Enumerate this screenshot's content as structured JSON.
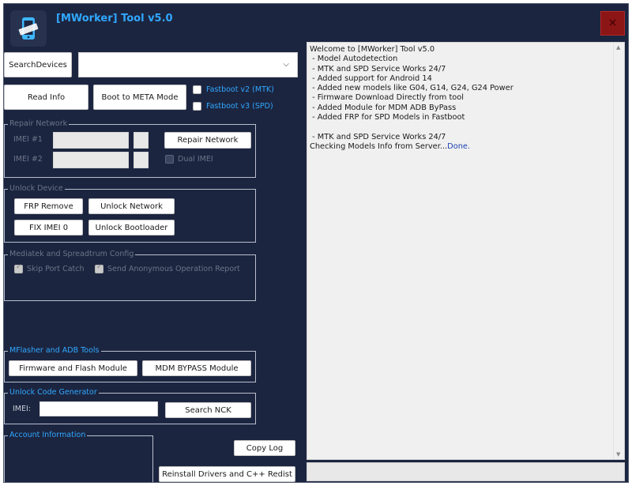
{
  "window": {
    "title": "[MWorker] Tool v5.0",
    "close_label": "×",
    "logo_icon": "phone-tool-icon"
  },
  "toolbar": {
    "search_devices_label": "SearchDevices",
    "device_select_value": "",
    "read_info_label": "Read Info",
    "boot_meta_label": "Boot to META Mode",
    "fastboot_v2_label": "Fastboot v2 (MTK)",
    "fastboot_v3_label": "Fastboot v3 (SPD)"
  },
  "repair_network": {
    "title": "Repair Network",
    "imei1_label": "IMEI #1",
    "imei2_label": "IMEI #2",
    "imei1_value": "",
    "imei2_value": "",
    "repair_button": "Repair Network",
    "dual_imei_label": "Dual IMEI"
  },
  "unlock_device": {
    "title": "Unlock Device",
    "frp_remove": "FRP Remove",
    "unlock_network": "Unlock Network",
    "fix_imei": "FIX IMEI 0",
    "unlock_bootloader": "Unlock Bootloader"
  },
  "config": {
    "title": "Mediatek and Spreadtrum Config",
    "skip_port_catch": "Skip Port Catch",
    "send_report": "Send Anonymous Operation Report"
  },
  "mflasher": {
    "title": "MFlasher and ADB Tools",
    "firmware_button": "Firmware and Flash Module",
    "mdm_button": "MDM BYPASS Module"
  },
  "unlock_code": {
    "title": "Unlock Code Generator",
    "imei_label": "IMEI:",
    "imei_value": "",
    "search_button": "Search NCK"
  },
  "account": {
    "title": "Account Information"
  },
  "actions": {
    "copy_log": "Copy Log",
    "reinstall": "Reinstall Drivers and C++ Redist"
  },
  "log": {
    "lines": [
      "Welcome to [MWorker] Tool v5.0",
      " - Model Autodetection",
      " - MTK and SPD Service Works 24/7",
      " - Added support for Android 14",
      " - Added new models like G04, G14, G24, G24 Power",
      " - Firmware Download Directly from tool",
      " - Added Module for MDM ADB ByPass",
      " - Added FRP for SPD Models in Fastboot",
      "",
      " - MTK and SPD Service Works 24/7"
    ],
    "last_line_prefix": "Checking Models Info from Server...",
    "last_line_status": "Done."
  },
  "status_bar": {
    "text": ""
  },
  "colors": {
    "background": "#1c2540",
    "accent": "#30a8ff",
    "close": "#8c1515"
  }
}
